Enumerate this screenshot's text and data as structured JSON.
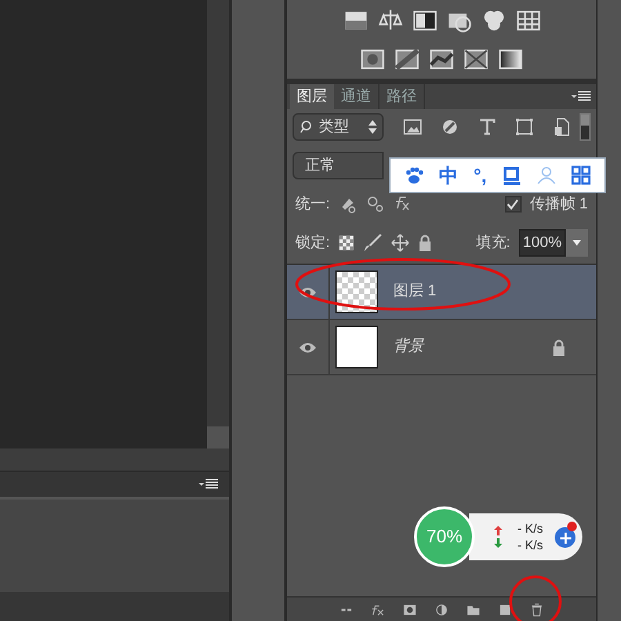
{
  "layers_panel": {
    "tabs": [
      {
        "label": "图层",
        "selected": true
      },
      {
        "label": "通道",
        "selected": false
      },
      {
        "label": "路径",
        "selected": false
      }
    ],
    "filter": {
      "value": "类型"
    },
    "blend_mode": {
      "value": "正常"
    },
    "unify": {
      "label": "统一:"
    },
    "propagate": {
      "label": "传播帧 1",
      "checked": true
    },
    "lock": {
      "label": "锁定:"
    },
    "fill": {
      "label": "填充:",
      "value": "100%"
    },
    "layers": [
      {
        "name": "图层 1",
        "kind": "normal",
        "selected": true,
        "visible": true,
        "locked": false
      },
      {
        "name": "背景",
        "kind": "background",
        "selected": false,
        "visible": true,
        "locked": true
      }
    ]
  },
  "ime_toolbar": {
    "items": [
      "中",
      "°,"
    ]
  },
  "speed_widget": {
    "percent": "70%",
    "upload": "- K/s",
    "download": "- K/s"
  }
}
